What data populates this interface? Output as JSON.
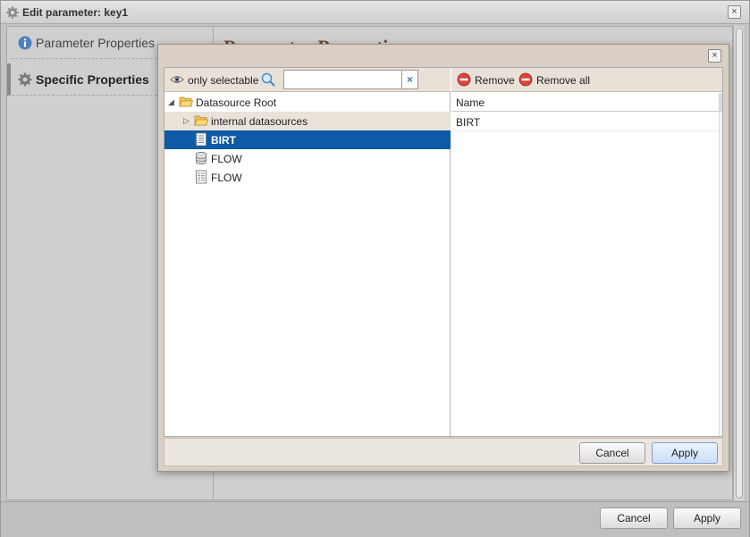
{
  "window": {
    "title": "Edit parameter: key1",
    "title_icon": "gear-icon",
    "close_glyph": "×"
  },
  "nav": {
    "items": [
      {
        "label": "Parameter Properties",
        "icon": "info-icon",
        "active": false
      },
      {
        "label": "Specific Properties",
        "icon": "gear-icon",
        "active": true
      }
    ]
  },
  "content": {
    "heading": "Parameter Properties"
  },
  "dialog": {
    "close_glyph": "×",
    "left_toolbar": {
      "only_selectable_label": "only selectable",
      "only_selectable_icon": "eye-icon",
      "search_icon": "magnifier-icon",
      "search_value": "",
      "clear_glyph": "×"
    },
    "tree": [
      {
        "label": "Datasource Root",
        "icon": "folder-open-icon",
        "depth": 0,
        "arrow": "◢",
        "state": ""
      },
      {
        "label": "internal datasources",
        "icon": "folder-open-icon",
        "depth": 1,
        "arrow": "▷",
        "state": "hover"
      },
      {
        "label": "BIRT",
        "icon": "report-icon",
        "depth": 1,
        "arrow": "",
        "state": "selected"
      },
      {
        "label": "FLOW",
        "icon": "database-icon",
        "depth": 1,
        "arrow": "",
        "state": ""
      },
      {
        "label": "FLOW",
        "icon": "document-icon",
        "depth": 1,
        "arrow": "",
        "state": ""
      }
    ],
    "right_toolbar": {
      "remove_label": "Remove",
      "remove_all_label": "Remove all",
      "remove_icon": "minus-circle-icon"
    },
    "list": {
      "header": "Name",
      "rows": [
        "BIRT"
      ]
    },
    "footer": {
      "cancel_label": "Cancel",
      "apply_label": "Apply"
    }
  },
  "window_footer": {
    "cancel_label": "Cancel",
    "apply_label": "Apply"
  },
  "colors": {
    "selection": "#0e5aa7",
    "heading": "#6b4a35",
    "remove_red": "#d9453a"
  }
}
